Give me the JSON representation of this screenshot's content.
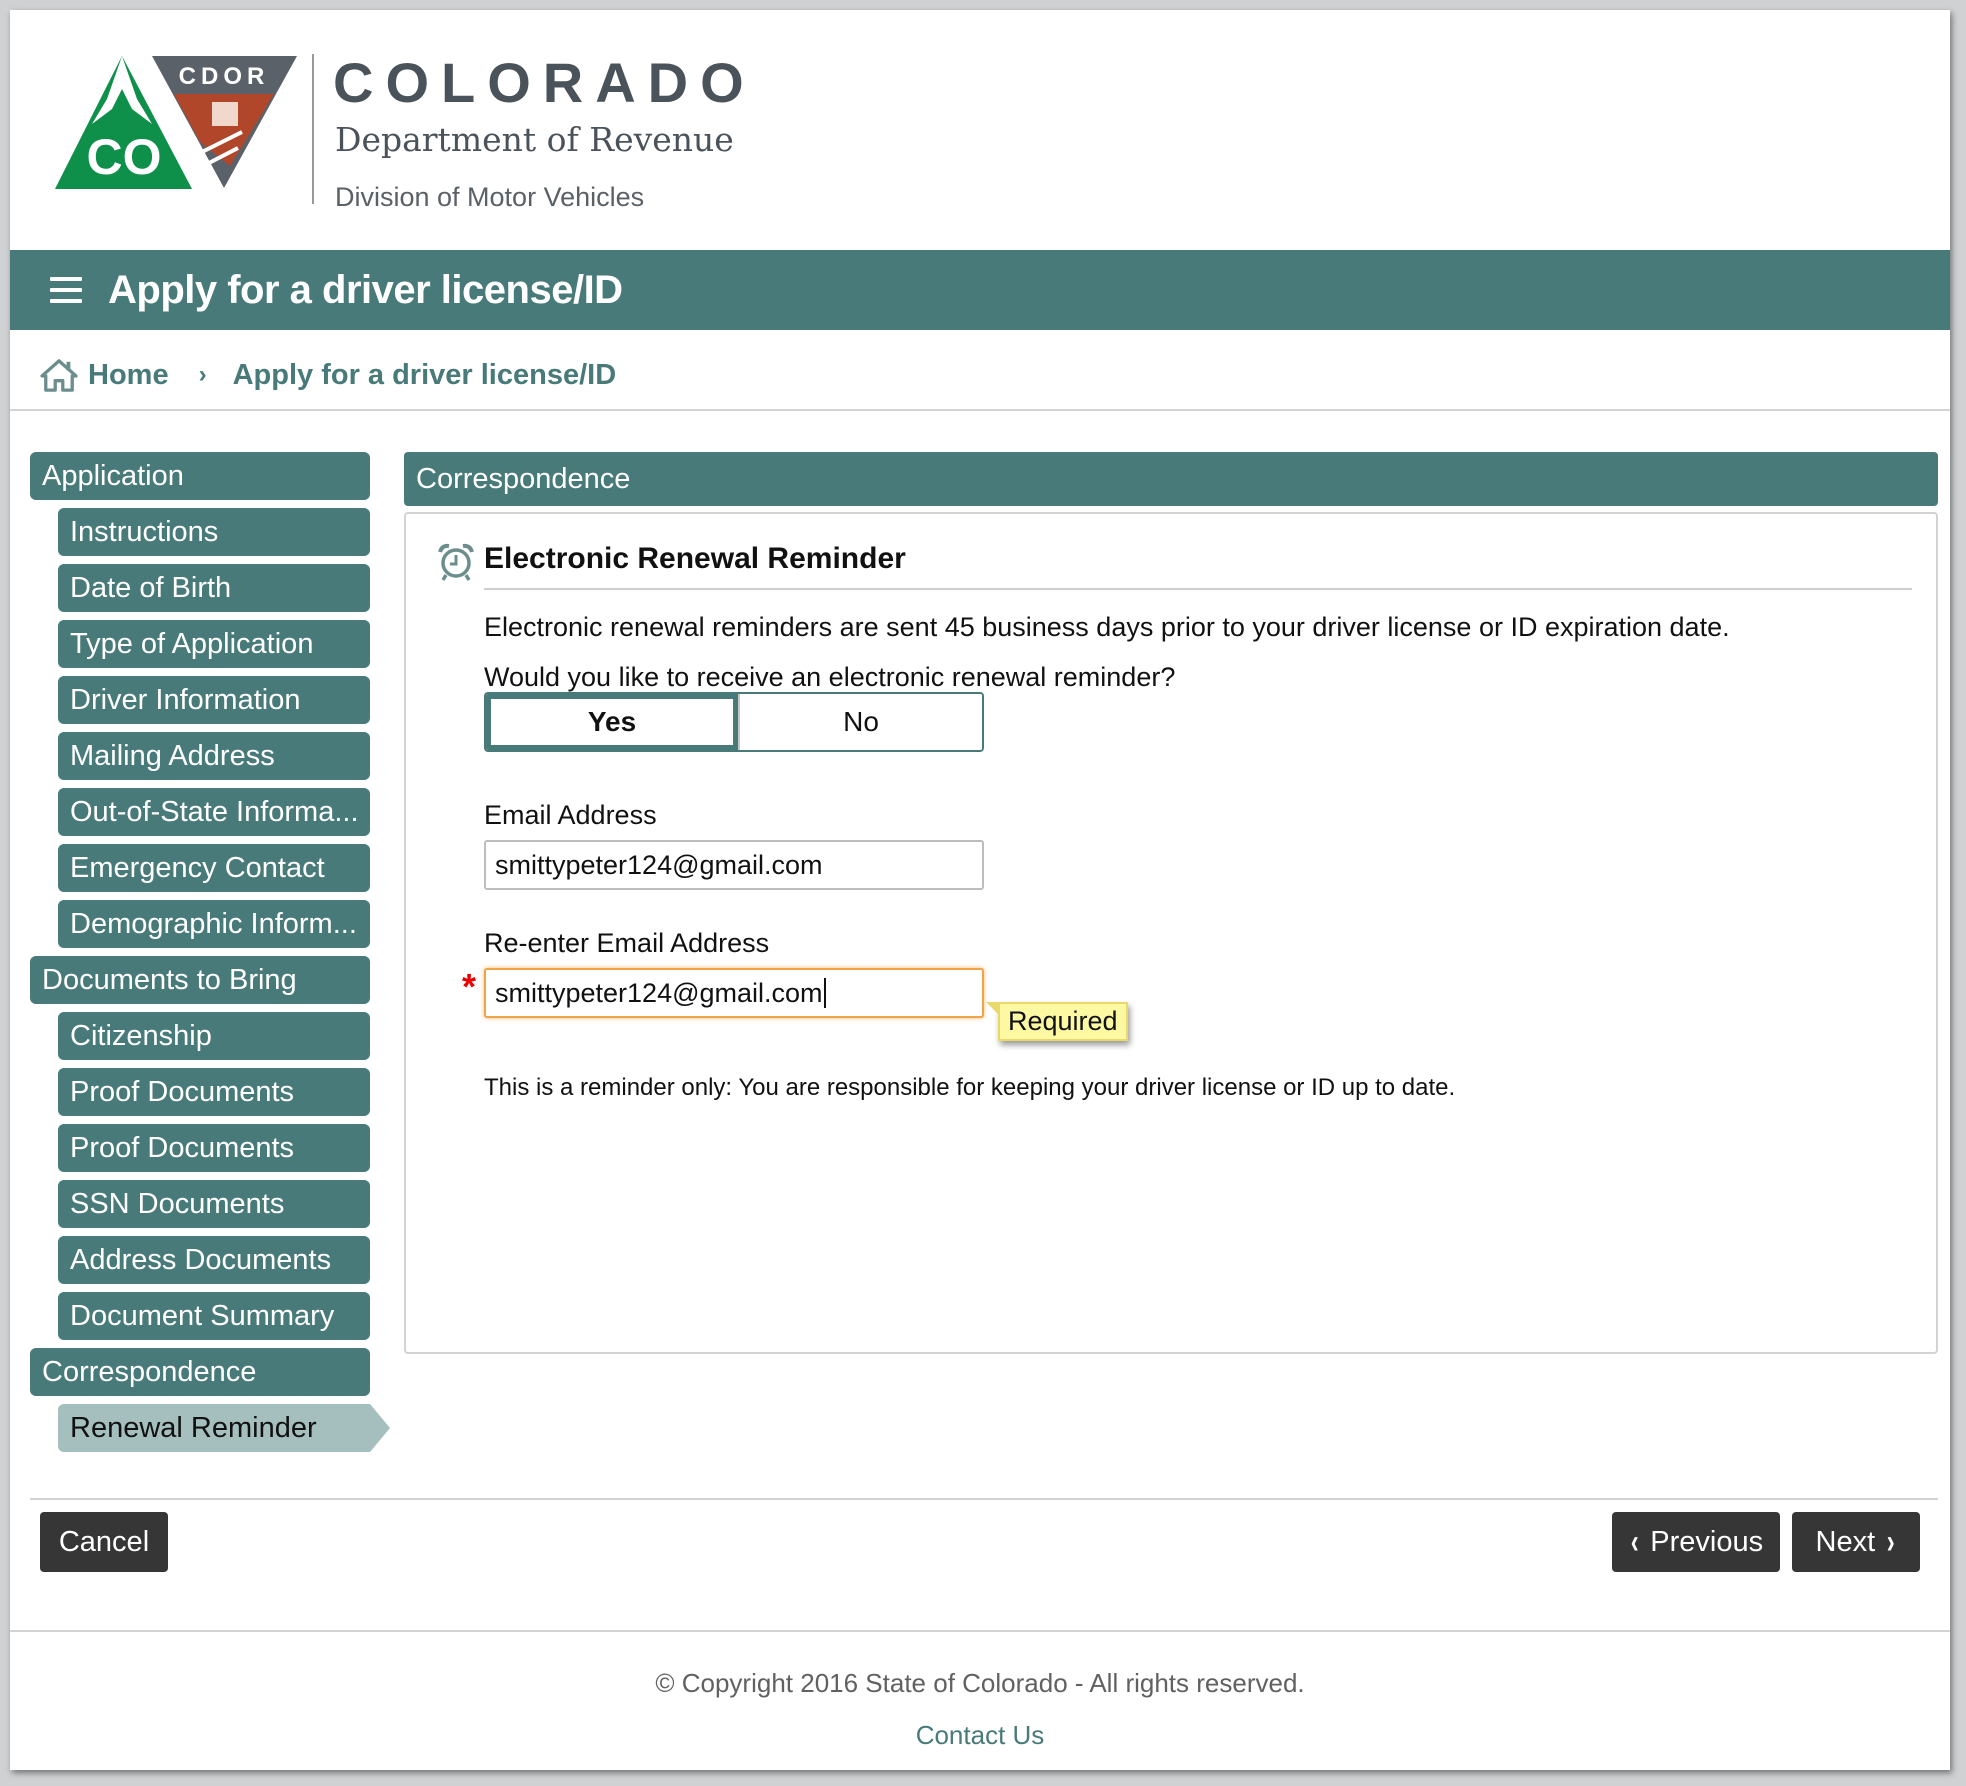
{
  "brand": {
    "logo_badge_text": "CDOR",
    "logo_state_text": "CO",
    "title": "COLORADO",
    "subtitle": "Department of Revenue",
    "division": "Division of Motor Vehicles"
  },
  "header": {
    "menu_icon": "hamburger-menu-icon",
    "title": "Apply for a driver license/ID"
  },
  "breadcrumb": {
    "home_icon": "home-icon",
    "items": [
      "Home",
      "Apply for a driver license/ID"
    ],
    "separator": "›"
  },
  "sidebar": {
    "items": [
      {
        "label": "Application",
        "level": "section"
      },
      {
        "label": "Instructions",
        "level": "sub"
      },
      {
        "label": "Date of Birth",
        "level": "sub"
      },
      {
        "label": "Type of Application",
        "level": "sub"
      },
      {
        "label": "Driver Information",
        "level": "sub"
      },
      {
        "label": "Mailing Address",
        "level": "sub"
      },
      {
        "label": "Out-of-State Informa...",
        "level": "sub"
      },
      {
        "label": "Emergency Contact",
        "level": "sub"
      },
      {
        "label": "Demographic Inform...",
        "level": "sub"
      },
      {
        "label": "Documents to Bring",
        "level": "section"
      },
      {
        "label": "Citizenship",
        "level": "sub"
      },
      {
        "label": "Proof Documents",
        "level": "sub"
      },
      {
        "label": "Proof Documents",
        "level": "sub"
      },
      {
        "label": "SSN Documents",
        "level": "sub"
      },
      {
        "label": "Address Documents",
        "level": "sub"
      },
      {
        "label": "Document Summary",
        "level": "sub"
      },
      {
        "label": "Correspondence",
        "level": "section"
      },
      {
        "label": "Renewal Reminder",
        "level": "sub",
        "active": true
      }
    ]
  },
  "main": {
    "panel_title": "Correspondence",
    "section_icon": "alarm-clock-icon",
    "section_title": "Electronic Renewal Reminder",
    "intro": "Electronic renewal reminders are sent 45 business days prior to your driver license or ID expiration date.",
    "question": "Would you like to receive an electronic renewal reminder?",
    "toggle": {
      "options": [
        "Yes",
        "No"
      ],
      "selected": "Yes"
    },
    "email_label": "Email Address",
    "email_value": "smittypeter124@gmail.com",
    "reenter_label": "Re-enter Email Address",
    "reenter_value": "smittypeter124@gmail.com",
    "required_marker": "*",
    "tooltip": "Required",
    "disclaimer": "This is a reminder only: You are responsible for keeping your driver license or ID up to date."
  },
  "actions": {
    "cancel": "Cancel",
    "previous": "Previous",
    "next": "Next",
    "prev_chevron": "‹",
    "next_chevron": "›"
  },
  "footer": {
    "copyright": "© Copyright 2016 State of Colorado - All rights reserved.",
    "contact": "Contact Us"
  },
  "colors": {
    "primary": "#487a79",
    "active_nav": "#a5bfbe",
    "button_dark": "#363636",
    "focus_border": "#f0a44a",
    "tooltip_bg": "#fdf9a2",
    "required": "#e00000",
    "logo_green": "#0e8f4a",
    "logo_red": "#b1472a",
    "logo_gray": "#5a6168"
  }
}
